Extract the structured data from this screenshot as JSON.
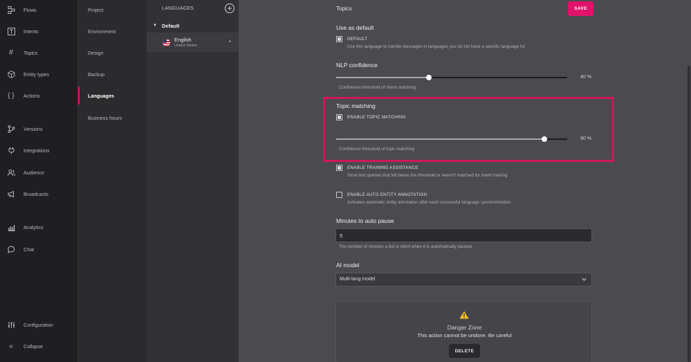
{
  "nav": {
    "items": [
      {
        "label": "Flows",
        "icon": "flows-icon"
      },
      {
        "label": "Intents",
        "icon": "intents-icon"
      },
      {
        "label": "Topics",
        "icon": "topics-icon"
      },
      {
        "label": "Entity types",
        "icon": "entity-types-icon"
      },
      {
        "label": "Actions",
        "icon": "actions-icon"
      },
      {
        "label": "Versions",
        "icon": "versions-icon"
      },
      {
        "label": "Integrations",
        "icon": "integrations-icon"
      },
      {
        "label": "Audience",
        "icon": "audience-icon"
      },
      {
        "label": "Broadcasts",
        "icon": "broadcasts-icon"
      },
      {
        "label": "Analytics",
        "icon": "analytics-icon"
      },
      {
        "label": "Chat",
        "icon": "chat-icon"
      },
      {
        "label": "Configuration",
        "icon": "configuration-icon"
      },
      {
        "label": "Collapse",
        "icon": "collapse-icon"
      }
    ]
  },
  "subnav": {
    "items": [
      {
        "label": "Project"
      },
      {
        "label": "Environment"
      },
      {
        "label": "Design"
      },
      {
        "label": "Backup"
      },
      {
        "label": "Languages",
        "active": true
      },
      {
        "label": "Business hours"
      }
    ]
  },
  "languages": {
    "title": "LANGUAGES",
    "add_icon": "plus-circle-icon",
    "group": "Default",
    "items": [
      {
        "name": "English",
        "region": "United States",
        "flag": "us-flag-icon",
        "marker": "*"
      }
    ]
  },
  "header": {
    "title": "Topics",
    "save_label": "SAVE"
  },
  "settings": {
    "use_as_default": {
      "heading": "Use as default",
      "checkbox_label": "DEFAULT",
      "checked": true,
      "help": "Use this language to handle messages in languages you do not have a specific language for"
    },
    "nlp_confidence": {
      "heading": "NLP confidence",
      "value": 40,
      "value_label": "40 %",
      "help": "Confidence threshold of intent matching"
    },
    "topic_matching": {
      "heading": "Topic matching",
      "checkbox_label": "ENABLE TOPIC MATCHING",
      "checked": true,
      "value": 90,
      "value_label": "90 %",
      "help": "Confidence threshold of topic matching"
    },
    "training_assistance": {
      "checkbox_label": "ENABLE TRAINING ASSISTANCE",
      "checked": true,
      "help": "Store text queries that fell below the threshold or weren't matched for intent training"
    },
    "auto_entity": {
      "checkbox_label": "ENABLE AUTO ENTITY ANNOTATION",
      "checked": false,
      "help": "Activates automatic entity annotation after each successful language synchronization"
    },
    "auto_pause": {
      "heading": "Minutes to auto pause",
      "value": "5",
      "help": "The number of minutes a bot is silent when it is automatically paused"
    },
    "ai_model": {
      "heading": "AI model",
      "selected": "Multi-lang model"
    },
    "danger_zone": {
      "icon": "warning-icon",
      "title": "Danger Zone",
      "subtitle": "This action cannot be undone. Be careful",
      "delete_label": "DELETE"
    }
  },
  "colors": {
    "accent": "#e0126a",
    "highlight_border": "#d0175c",
    "nav_bg": "#1f1f22",
    "main_bg": "#4b4b4f"
  }
}
